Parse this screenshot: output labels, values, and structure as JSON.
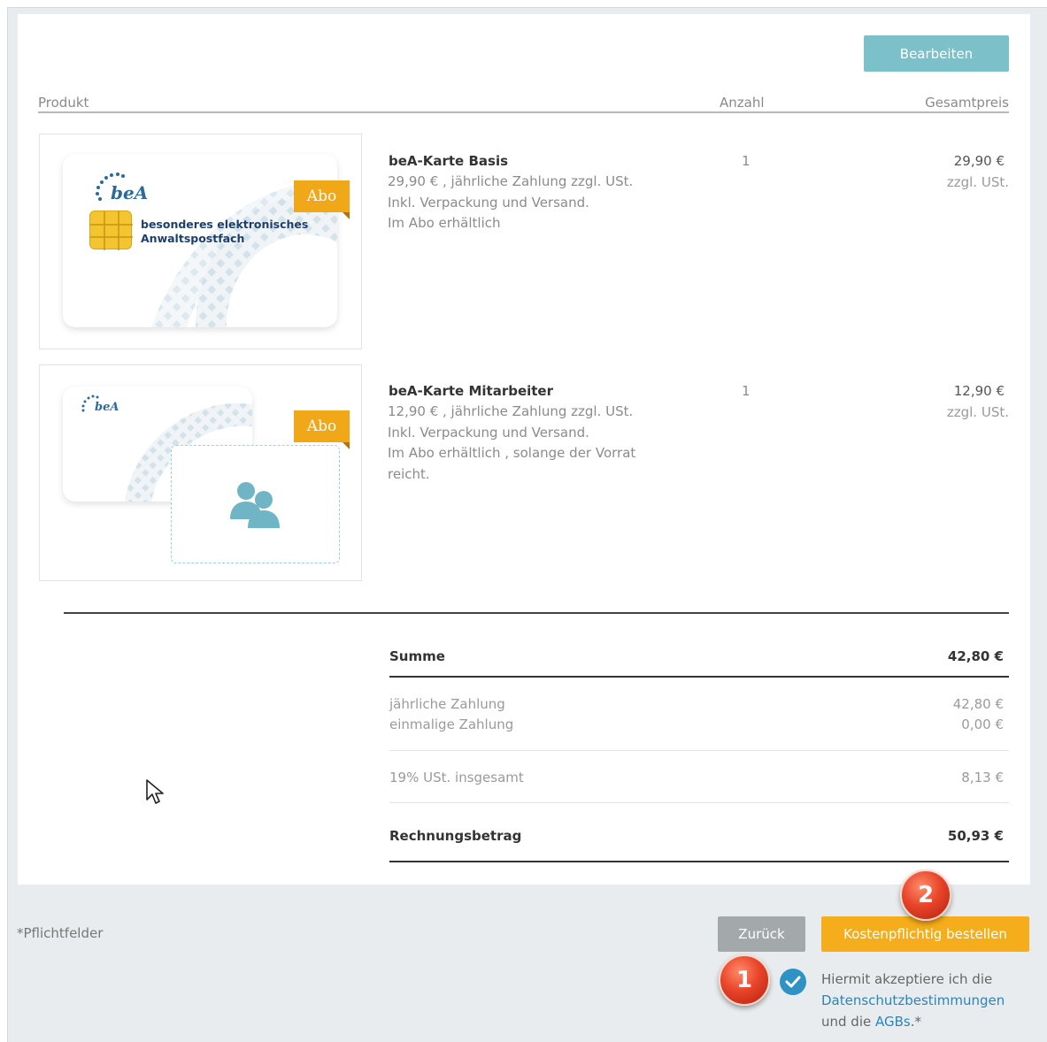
{
  "edit_button": "Bearbeiten",
  "table_header": {
    "product": "Produkt",
    "quantity": "Anzahl",
    "total_price": "Gesamtpreis"
  },
  "products": [
    {
      "title": "beA-Karte Basis",
      "desc": [
        "29,90 € , jährliche Zahlung   zzgl. USt.",
        "Inkl. Verpackung und Versand.",
        "Im Abo erhältlich"
      ],
      "quantity": "1",
      "price": "29,90  €",
      "price_note": "zzgl. USt.",
      "badge": "Abo",
      "card_brand": "beA",
      "card_text_line1": "besonderes elektronisches",
      "card_text_line2": "Anwaltspostfach"
    },
    {
      "title": "beA-Karte Mitarbeiter",
      "desc": [
        "12,90 € , jährliche Zahlung   zzgl. USt.",
        "Inkl. Verpackung und Versand.",
        "Im Abo erhältlich , solange der Vorrat",
        "reicht."
      ],
      "quantity": "1",
      "price": "12,90  €",
      "price_note": "zzgl. USt.",
      "badge": "Abo",
      "card_brand": "beA"
    }
  ],
  "summary": {
    "sum_label": "Summe",
    "sum_value": "42,80 €",
    "annual_label": "jährliche Zahlung",
    "annual_value": "42,80 €",
    "once_label": "einmalige Zahlung",
    "once_value": "0,00 €",
    "tax_label": "19% USt. insgesamt",
    "tax_value": "8,13 €",
    "invoice_label": "Rechnungsbetrag",
    "invoice_value": "50,93 €"
  },
  "footer": {
    "required_note": "*Pflichtfelder",
    "back_button": "Zurück",
    "order_button": "Kostenpflichtig bestellen",
    "consent_pre": "Hiermit akzeptiere ich die",
    "privacy_link": "Datenschutzbestimmungen",
    "consent_and": "und die",
    "terms_link": "AGBs",
    "consent_post": ".*",
    "consent_checked": true
  },
  "markers": [
    "1",
    "2"
  ],
  "colors": {
    "accent_teal": "#7cc0c9",
    "order_orange": "#f6ad1b",
    "back_gray": "#a3a8ab",
    "check_blue": "#2f92c5",
    "marker_red": "#e8452a"
  },
  "icons": [
    "cursor-arrow-icon",
    "checkmark-icon",
    "users-icon",
    "sim-chip-icon"
  ]
}
